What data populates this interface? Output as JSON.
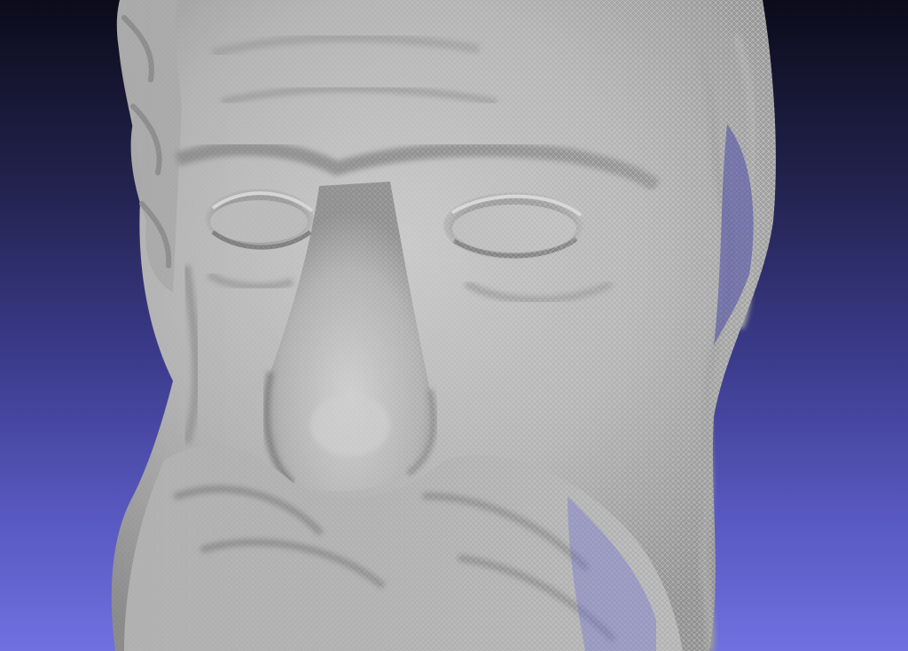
{
  "viewer": {
    "background": {
      "top_color": "#0b0b1a",
      "bottom_color": "#7070e0"
    },
    "mesh": {
      "surface_color": "#b8b8b8",
      "wireframe_color": "#dcdcdc",
      "render_modes": [
        "smooth-shaded",
        "wireframe"
      ]
    }
  }
}
